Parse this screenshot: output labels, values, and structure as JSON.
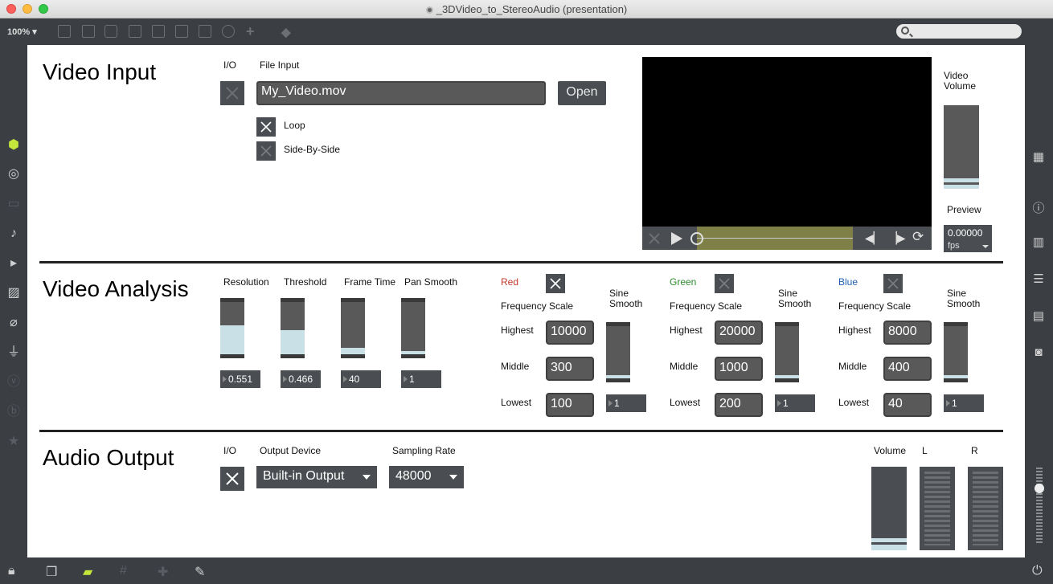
{
  "window": {
    "title": "_3DVideo_to_StereoAudio (presentation)"
  },
  "toolbar": {
    "zoom": "100%"
  },
  "video_input": {
    "heading": "Video Input",
    "io_label": "I/O",
    "file_input_label": "File Input",
    "file_name": "My_Video.mov",
    "open_label": "Open",
    "loop_label": "Loop",
    "side_by_side_label": "Side-By-Side",
    "video_volume_label": "Video\nVolume",
    "video_volume_level": 0.08,
    "preview_label": "Preview",
    "fps_value": "0.00000",
    "fps_unit": "fps"
  },
  "video_analysis": {
    "heading": "Video Analysis",
    "sliders": [
      {
        "label": "Resolution",
        "value": "0.551",
        "level": 0.551
      },
      {
        "label": "Threshold",
        "value": "0.466",
        "level": 0.466
      },
      {
        "label": "Frame Time",
        "value": "40",
        "level": 0.12
      },
      {
        "label": "Pan Smooth",
        "value": "1",
        "level": 0.06
      }
    ],
    "channels": [
      {
        "name": "Red",
        "color": "#c0392b",
        "frequency_scale_label": "Frequency Scale",
        "sine_smooth_label": "Sine\nSmooth",
        "highest_label": "Highest",
        "middle_label": "Middle",
        "lowest_label": "Lowest",
        "highest": "10000",
        "middle": "300",
        "lowest": "100",
        "smooth": "1",
        "smooth_level": 0.06
      },
      {
        "name": "Green",
        "color": "#2e8b2e",
        "frequency_scale_label": "Frequency Scale",
        "sine_smooth_label": "Sine\nSmooth",
        "highest_label": "Highest",
        "middle_label": "Middle",
        "lowest_label": "Lowest",
        "highest": "20000",
        "middle": "1000",
        "lowest": "200",
        "smooth": "1",
        "smooth_level": 0.06
      },
      {
        "name": "Blue",
        "color": "#1f5fb0",
        "frequency_scale_label": "Frequency Scale",
        "sine_smooth_label": "Sine\nSmooth",
        "highest_label": "Highest",
        "middle_label": "Middle",
        "lowest_label": "Lowest",
        "highest": "8000",
        "middle": "400",
        "lowest": "40",
        "smooth": "1",
        "smooth_level": 0.06
      }
    ]
  },
  "audio_output": {
    "heading": "Audio Output",
    "io_label": "I/O",
    "output_device_label": "Output Device",
    "output_device": "Built-in Output",
    "sampling_rate_label": "Sampling Rate",
    "sampling_rate": "48000",
    "volume_label": "Volume",
    "volume_level": 0.1,
    "left_label": "L",
    "right_label": "R"
  },
  "icons": {
    "left": [
      "cube-icon",
      "target-icon",
      "keyboard-icon",
      "music-note-icon",
      "playlist-icon",
      "image-icon",
      "paperclip-icon",
      "plug-icon",
      "v-badge-icon",
      "b-badge-icon",
      "star-icon"
    ],
    "right": [
      "grid-icon",
      "info-icon",
      "book-open-icon",
      "list-icon",
      "book-icon",
      "camera-icon"
    ],
    "bottom": [
      "lock-icon",
      "windows-icon",
      "presentation-icon",
      "grid-lines-icon",
      "add-snap-icon",
      "wrench-icon",
      "power-icon"
    ]
  }
}
